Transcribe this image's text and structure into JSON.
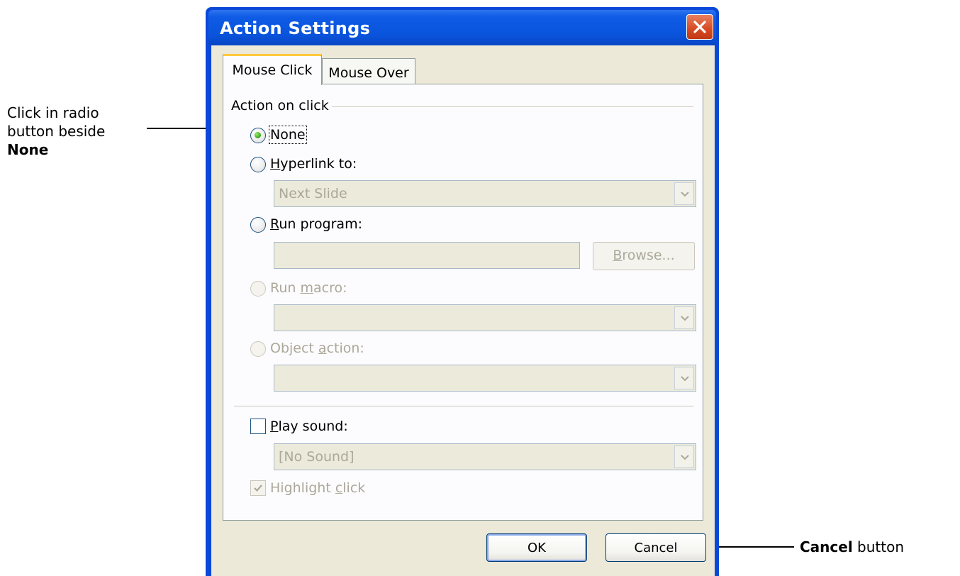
{
  "callouts": {
    "left_text_line1": "Click in radio",
    "left_text_line2": "button beside",
    "left_text_bold": "None",
    "right_text_bold": "Cancel",
    "right_text_rest": " button"
  },
  "dialog": {
    "title": "Action Settings",
    "close_icon": "close-icon",
    "tabs": [
      {
        "label": "Mouse Click",
        "active": true
      },
      {
        "label": "Mouse Over",
        "active": false
      }
    ],
    "group_label": "Action on click",
    "options": {
      "none": {
        "label": "None",
        "selected": true
      },
      "hyperlink": {
        "label_first": "H",
        "label_rest": "yperlink to:",
        "value": "Next Slide"
      },
      "run_program": {
        "label_first": "R",
        "label_rest": "un program:",
        "value": "",
        "browse_first": "B",
        "browse_rest": "rowse..."
      },
      "run_macro": {
        "label_pre": "Run ",
        "label_ul": "m",
        "label_post": "acro:",
        "value": ""
      },
      "object_action": {
        "label_pre": "Object ",
        "label_ul": "a",
        "label_post": "ction:",
        "value": ""
      }
    },
    "play_sound": {
      "label_first": "P",
      "label_rest": "lay sound:",
      "checked": false,
      "value": "[No Sound]"
    },
    "highlight_click": {
      "label_pre": "Highlight ",
      "label_ul": "c",
      "label_post": "lick",
      "checked": true
    },
    "buttons": {
      "ok": "OK",
      "cancel": "Cancel"
    }
  }
}
